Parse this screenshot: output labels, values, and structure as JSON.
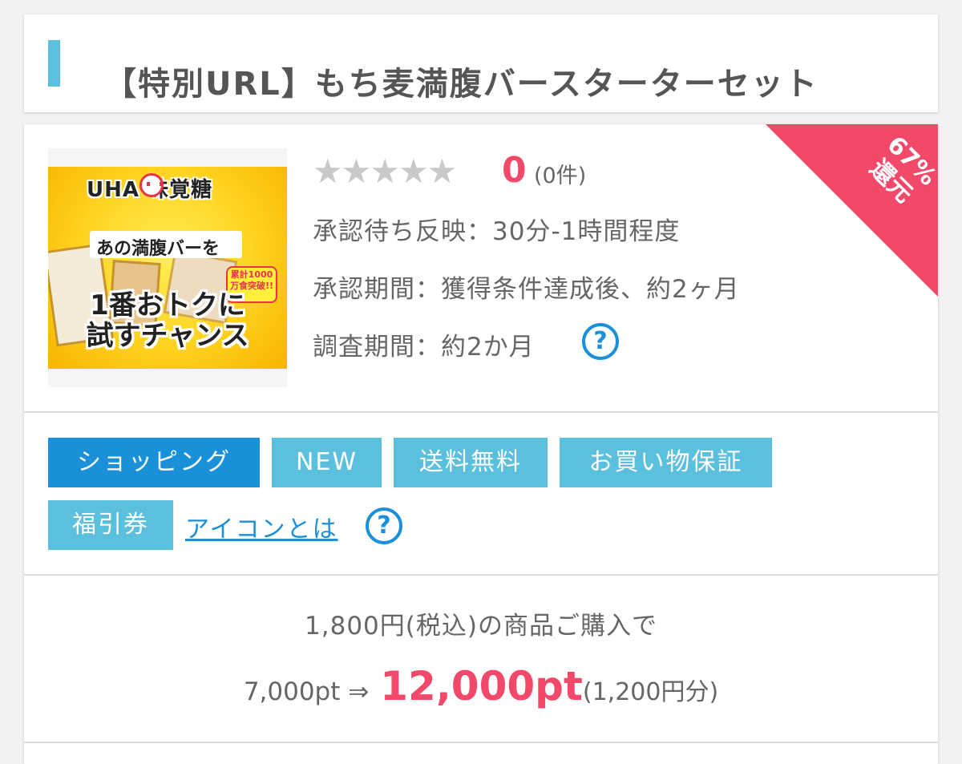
{
  "title": "【特別URL】もち麦満腹バースターターセット",
  "ribbon": {
    "percent": "67%",
    "label": "還元"
  },
  "product_image": {
    "brand": "UHA 味覚糖",
    "subtitle": "あの満腹バーを",
    "badge": "累計1000万食突破!!",
    "headline_1": "1番おトクに",
    "headline_2": "試すチャンス"
  },
  "rating": {
    "stars": [
      "★",
      "★",
      "★",
      "★",
      "★"
    ],
    "value": "0",
    "count": "(0件)",
    "score": 0
  },
  "info": {
    "approval_wait": "承認待ち反映：30分-1時間程度",
    "approval_period": "承認期間：獲得条件達成後、約2ヶ月",
    "survey_period": "調査期間：約2か月"
  },
  "help_icon": "?",
  "tags": [
    "ショッピング",
    "NEW",
    "送料無料",
    "お買い物保証",
    "福引券"
  ],
  "icon_link": "アイコンとは",
  "points": {
    "condition": "1,800円(税込)の商品ご購入で",
    "before": "7,000pt ⇒",
    "after": "12,000pt",
    "yen": "(1,200円分)"
  },
  "colors": {
    "accent_pink": "#f2486a",
    "accent_blue": "#1a90d9",
    "tag_light": "#5bc0de"
  }
}
